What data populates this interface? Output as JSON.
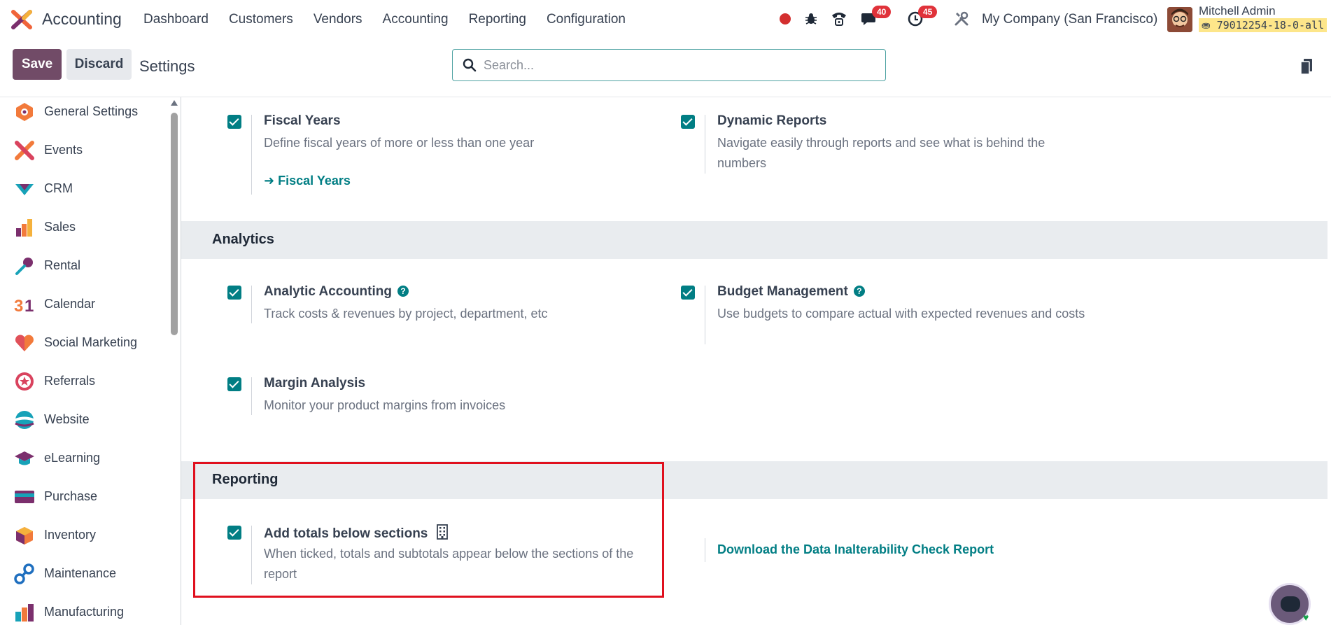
{
  "app": {
    "name": "Accounting"
  },
  "menu": [
    "Dashboard",
    "Customers",
    "Vendors",
    "Accounting",
    "Reporting",
    "Configuration"
  ],
  "systray": {
    "messages_count": "40",
    "activities_count": "45",
    "company": "My Company (San Francisco)"
  },
  "user": {
    "name": "Mitchell Admin",
    "db": "79012254-18-0-all"
  },
  "control": {
    "save": "Save",
    "discard": "Discard",
    "title": "Settings",
    "search_placeholder": "Search..."
  },
  "sidebar": [
    "General Settings",
    "Events",
    "CRM",
    "Sales",
    "Rental",
    "Calendar",
    "Social Marketing",
    "Referrals",
    "Website",
    "eLearning",
    "Purchase",
    "Inventory",
    "Maintenance",
    "Manufacturing"
  ],
  "fiscal": {
    "fiscal_years": {
      "title": "Fiscal Years",
      "desc": "Define fiscal years of more or less than one year",
      "link": "Fiscal Years"
    },
    "dynamic_reports": {
      "title": "Dynamic Reports",
      "desc": "Navigate easily through reports and see what is behind the numbers"
    }
  },
  "analytics": {
    "title": "Analytics",
    "analytic_accounting": {
      "title": "Analytic Accounting",
      "desc": "Track costs & revenues by project, department, etc"
    },
    "budget_management": {
      "title": "Budget Management",
      "desc": "Use budgets to compare actual with expected revenues and costs"
    },
    "margin_analysis": {
      "title": "Margin Analysis",
      "desc": "Monitor your product margins from invoices"
    }
  },
  "reporting": {
    "title": "Reporting",
    "totals_below": {
      "title": "Add totals below sections",
      "desc": "When ticked, totals and subtotals appear below the sections of the report"
    },
    "download_link": "Download the Data Inalterability Check Report"
  },
  "colors": {
    "brand": "#714b67",
    "accent": "#017e84",
    "highlight": "#e0101e"
  }
}
